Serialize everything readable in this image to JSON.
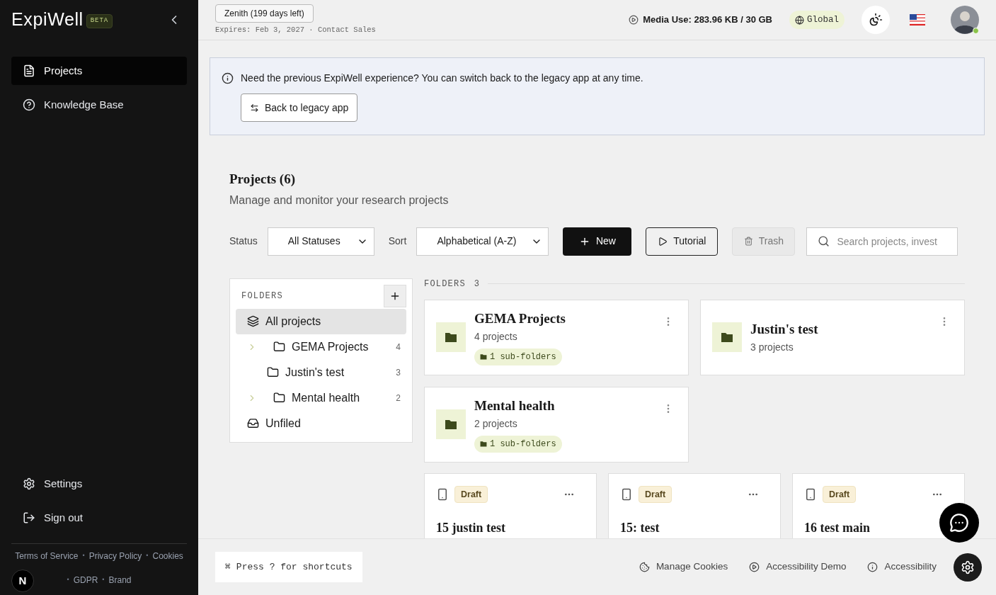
{
  "sidebar": {
    "logo": "ExpiWell",
    "badge": "BETA",
    "nav": [
      {
        "label": "Projects",
        "kind": "projects",
        "selected": true
      },
      {
        "label": "Knowledge Base",
        "kind": "help",
        "selected": false
      }
    ],
    "bottom_nav": [
      {
        "label": "Settings",
        "kind": "settings"
      },
      {
        "label": "Sign out",
        "kind": "signout"
      }
    ],
    "legal_links": [
      "Terms of Service",
      "Privacy Policy",
      "Cookies",
      "GDPR",
      "Brand"
    ],
    "separator": "•",
    "badge_letter": "N"
  },
  "header": {
    "plan": "Zenith (199 days left)",
    "expires": "Expires: Feb 3, 2027 · Contact Sales",
    "media_use": "Media Use: 283.96 KB / 30 GB",
    "region": "Global"
  },
  "banner": {
    "message": "Need the previous ExpiWell experience? You can switch back to the legacy app at any time.",
    "button": "Back to legacy app"
  },
  "projects": {
    "title": "Projects (6)",
    "subtitle": "Manage and monitor your research projects",
    "status_label": "Status",
    "status_value": "All Statuses",
    "sort_label": "Sort",
    "sort_value": "Alphabetical (A-Z)",
    "new_button": "New",
    "tutorial_button": "Tutorial",
    "trash_button": "Trash",
    "search_placeholder": "Search projects, invest"
  },
  "folder_tree": {
    "heading": "FOLDERS",
    "items": [
      {
        "label": "All projects",
        "kind": "all",
        "selected": true
      },
      {
        "label": "GEMA Projects",
        "kind": "folder",
        "count": "4",
        "expandable": true,
        "selected": false
      },
      {
        "label": "Justin's test",
        "kind": "folder",
        "count": "3",
        "expandable": false,
        "selected": false
      },
      {
        "label": "Mental health",
        "kind": "folder",
        "count": "2",
        "expandable": true,
        "selected": false
      },
      {
        "label": "Unfiled",
        "kind": "unfiled",
        "selected": false
      }
    ]
  },
  "folders_section": {
    "heading": "FOLDERS",
    "count": "3",
    "folders": [
      {
        "name": "GEMA Projects",
        "count": "4 projects",
        "subfolders": "1 sub-folders"
      },
      {
        "name": "Justin's test",
        "count": "3 projects"
      },
      {
        "name": "Mental health",
        "count": "2 projects",
        "subfolders": "1 sub-folders"
      }
    ]
  },
  "project_cards": [
    {
      "status": "Draft",
      "title": "15 justin test"
    },
    {
      "status": "Draft",
      "title": "15: test"
    },
    {
      "status": "Draft",
      "title": "16 test main"
    }
  ],
  "footer": {
    "shortcut_icon": "⌘",
    "shortcut_hint": "Press ? for shortcuts",
    "links": [
      {
        "label": "Manage Cookies",
        "kind": "cookie"
      },
      {
        "label": "Accessibility Demo",
        "kind": "play"
      },
      {
        "label": "Accessibility",
        "kind": "info"
      }
    ]
  }
}
